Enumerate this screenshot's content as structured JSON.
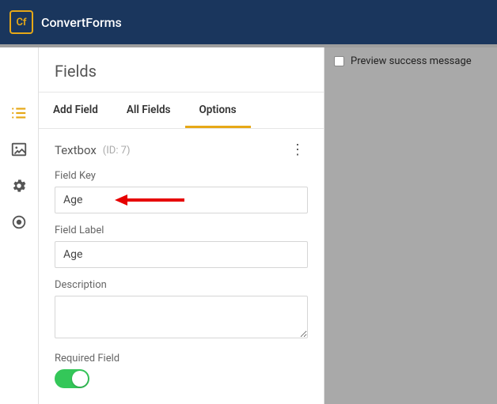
{
  "app": {
    "logo_text": "Cf",
    "title": "ConvertForms"
  },
  "panel": {
    "title": "Fields"
  },
  "tabs": {
    "add": "Add Field",
    "all": "All Fields",
    "options": "Options"
  },
  "field": {
    "type": "Textbox",
    "id_label": "(ID: 7)",
    "key_label": "Field Key",
    "key_value": "Age",
    "label_label": "Field Label",
    "label_value": "Age",
    "desc_label": "Description",
    "desc_value": "",
    "required_label": "Required Field"
  },
  "preview": {
    "checkbox_label": "Preview success message"
  }
}
